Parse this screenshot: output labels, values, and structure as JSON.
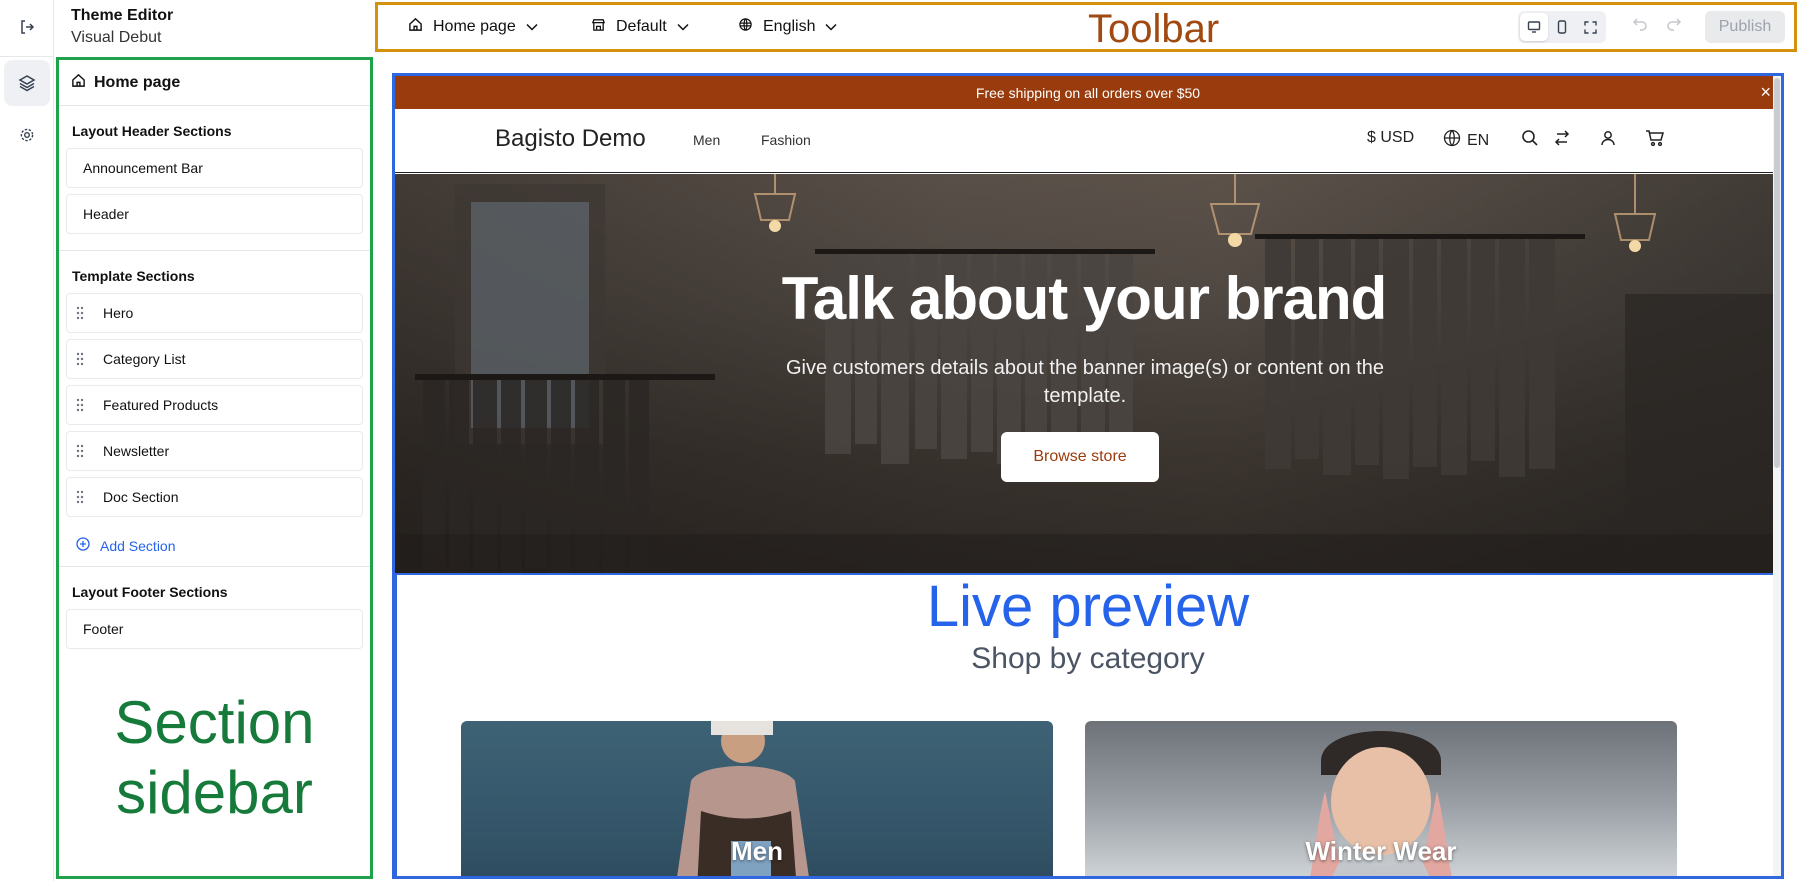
{
  "app": {
    "title": "Theme Editor",
    "subtitle": "Visual Debut"
  },
  "rail": {
    "icons": [
      "exit-icon",
      "layers-icon",
      "gear-icon"
    ]
  },
  "sidebar": {
    "home": "Home page",
    "header_group": {
      "title": "Layout Header Sections",
      "items": [
        "Announcement Bar",
        "Header"
      ]
    },
    "template_group": {
      "title": "Template Sections",
      "items": [
        "Hero",
        "Category List",
        "Featured Products",
        "Newsletter",
        "Doc Section"
      ],
      "add_label": "Add Section"
    },
    "footer_group": {
      "title": "Layout Footer Sections",
      "items": [
        "Footer"
      ]
    },
    "annotation": {
      "line1": "Section",
      "line2": "sidebar"
    }
  },
  "toolbar": {
    "page_select": "Home page",
    "theme_select": "Default",
    "language_select": "English",
    "annotation": "Toolbar",
    "publish_label": "Publish",
    "view_modes": [
      "desktop-icon",
      "mobile-icon",
      "fullscreen-icon"
    ]
  },
  "preview": {
    "announcement": "Free shipping on all orders over $50",
    "announcement_close": "×",
    "logo": "Bagisto Demo",
    "nav": [
      "Men",
      "Fashion"
    ],
    "currency": "$ USD",
    "locale": "EN",
    "hero": {
      "title": "Talk about your brand",
      "description": "Give customers details about the banner image(s) or content on the template.",
      "button": "Browse store"
    },
    "annotation": "Live preview",
    "shop_title": "Shop by category",
    "categories": [
      "Men",
      "Winter Wear"
    ]
  },
  "colors": {
    "sidebar_border": "#1fa34a",
    "toolbar_border": "#d4900f",
    "preview_border": "#2f67e0",
    "brand": "#9a3b0d",
    "link": "#2563eb"
  }
}
